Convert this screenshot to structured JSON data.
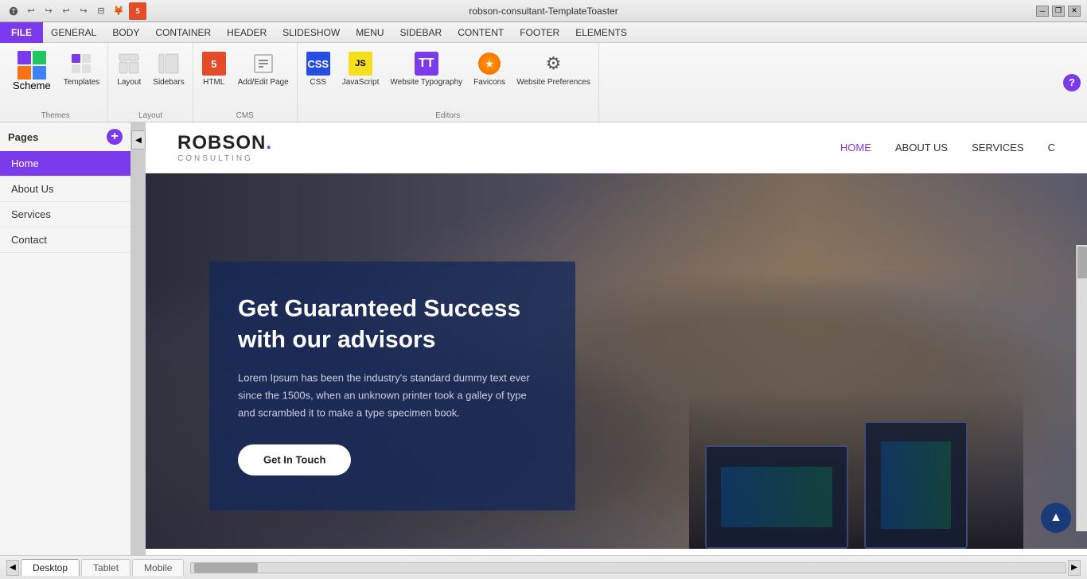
{
  "window": {
    "title": "robson-consultant-TemplateToaster",
    "close_label": "✕",
    "maximize_label": "❐",
    "minimize_label": "─"
  },
  "toolbar_icons": [
    "↩",
    "↪",
    "↩",
    "↪",
    "⊟",
    "🦊",
    "H"
  ],
  "menu": {
    "file_label": "FILE",
    "items": [
      "GENERAL",
      "BODY",
      "CONTAINER",
      "HEADER",
      "SLIDESHOW",
      "MENU",
      "SIDEBAR",
      "CONTENT",
      "FOOTER",
      "ELEMENTS"
    ]
  },
  "ribbon": {
    "themes_group": "Themes",
    "layout_group": "Layout",
    "cms_group": "CMS",
    "editors_group": "Editors",
    "scheme_label": "Scheme",
    "templates_label": "Templates",
    "layout_label": "Layout",
    "sidebars_label": "Sidebars",
    "html_label": "HTML",
    "addedit_label": "Add/Edit Page",
    "css_label": "CSS",
    "javascript_label": "JavaScript",
    "typography_label": "Website Typography",
    "favicons_label": "Favicons",
    "preferences_label": "Website Preferences",
    "help_label": "?"
  },
  "sidebar": {
    "title": "Pages",
    "add_label": "+",
    "items": [
      {
        "label": "Home",
        "active": true
      },
      {
        "label": "About Us",
        "active": false
      },
      {
        "label": "Services",
        "active": false
      },
      {
        "label": "Contact",
        "active": false
      }
    ]
  },
  "website": {
    "logo_main": "ROBSON.",
    "logo_sub": "CONSULTING",
    "nav_links": [
      "HOME",
      "ABOUT US",
      "SERVICES",
      "C"
    ],
    "hero": {
      "title": "Get Guaranteed Success with our advisors",
      "body": "Lorem Ipsum has been the industry's standard dummy text ever since the 1500s, when an unknown printer took a galley of type and scrambled it to make a type specimen book.",
      "cta_label": "Get In Touch"
    }
  },
  "bottom_tabs": [
    "Desktop",
    "Tablet",
    "Mobile"
  ],
  "collapse_icon": "◀"
}
